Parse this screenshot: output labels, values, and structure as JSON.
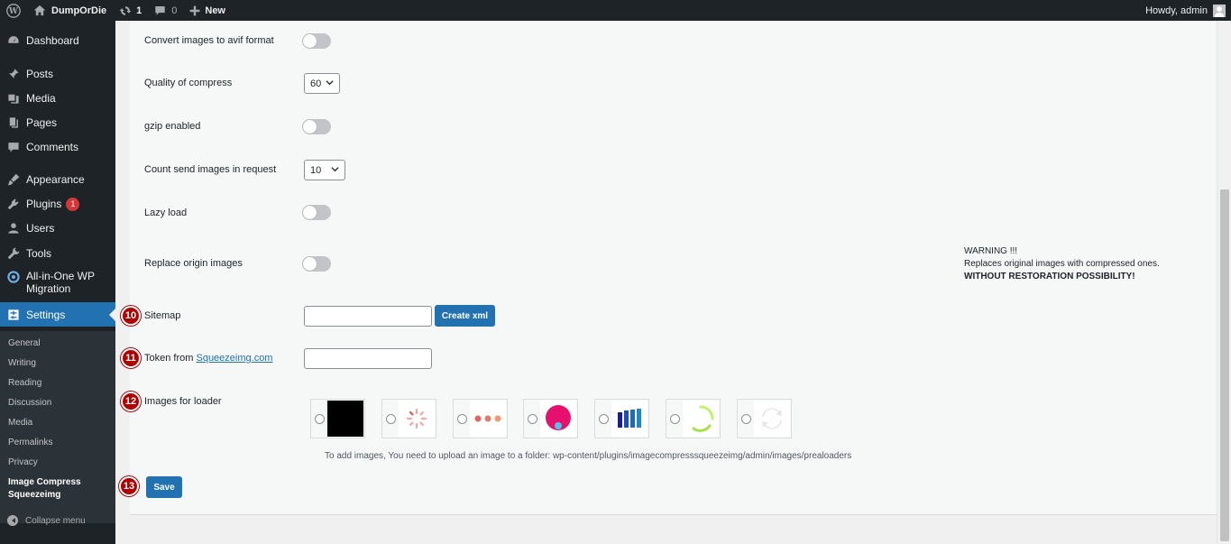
{
  "adminbar": {
    "site_name": "DumpOrDie",
    "updates_count": "1",
    "comments_count": "0",
    "new_label": "New",
    "howdy": "Howdy, admin"
  },
  "sidebar": {
    "items": [
      {
        "label": "Dashboard",
        "icon": "dashboard-icon"
      },
      {
        "label": "Posts",
        "icon": "pin-icon"
      },
      {
        "label": "Media",
        "icon": "media-icon"
      },
      {
        "label": "Pages",
        "icon": "pages-icon"
      },
      {
        "label": "Comments",
        "icon": "comment-icon"
      },
      {
        "label": "Appearance",
        "icon": "brush-icon"
      },
      {
        "label": "Plugins",
        "icon": "plugin-icon",
        "badge": "1"
      },
      {
        "label": "Users",
        "icon": "user-icon"
      },
      {
        "label": "Tools",
        "icon": "wrench-icon"
      },
      {
        "label": "All-in-One WP Migration",
        "icon": "migration-icon"
      },
      {
        "label": "Settings",
        "icon": "settings-icon",
        "current": true
      }
    ],
    "submenu": [
      "General",
      "Writing",
      "Reading",
      "Discussion",
      "Media",
      "Permalinks",
      "Privacy",
      "Image Compress Squeezeimg"
    ],
    "collapse_label": "Collapse menu"
  },
  "form": {
    "avif_label": "Convert images to avif format",
    "quality_label": "Quality of compress",
    "quality_value": "60",
    "gzip_label": "gzip enabled",
    "count_label": "Count send images in request",
    "count_value": "10",
    "lazy_label": "Lazy load",
    "replace_label": "Replace origin images",
    "warning_line1": "WARNING !!!",
    "warning_line2": "Replaces original images with compressed ones.",
    "warning_line3": "WITHOUT RESTORATION POSSIBILITY!",
    "sitemap_label": "Sitemap",
    "sitemap_value": "",
    "create_xml_label": "Create xml",
    "token_label": "Token from",
    "token_link": "Squeezeimg.com",
    "token_value": "",
    "loader_label": "Images for loader",
    "loader_hint": "To add images, You need to upload an image to a folder: wp-content/plugins/imagecompresssqueezeimg/admin/images/prealoaders",
    "save_label": "Save",
    "markers": [
      "10",
      "11",
      "12",
      "13"
    ]
  },
  "colors": {
    "accent": "#2271b1",
    "sidebar_bg": "#1d2327",
    "marker": "#b00000"
  }
}
